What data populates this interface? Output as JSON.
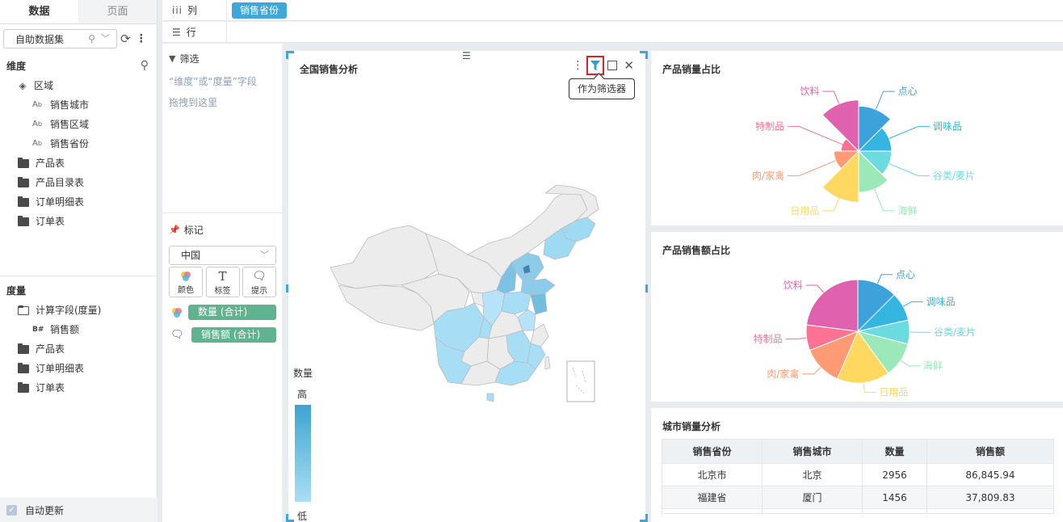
{
  "left": {
    "tabs": [
      "数据",
      "页面"
    ],
    "dataset": "自助数据集",
    "dim_title": "维度",
    "dim_root": "区域",
    "dim_children": [
      {
        "label": "销售城市"
      },
      {
        "label": "销售区域"
      },
      {
        "label": "销售省份"
      }
    ],
    "dim_tables": [
      "产品表",
      "产品目录表",
      "订单明细表",
      "订单表"
    ],
    "measure_title": "度量",
    "measure_root": "计算字段(度量)",
    "measure_child": "销售额",
    "measure_tables": [
      "产品表",
      "订单明细表",
      "订单表"
    ],
    "auto_update": "自动更新"
  },
  "bars": {
    "col_label": "列",
    "col_pill": "销售省份",
    "row_label": "行"
  },
  "mid": {
    "filter_title": "筛选",
    "filter_hint_1": "“维度”或“度量”字段",
    "filter_hint_2": "拖拽到这里",
    "mark_title": "标记",
    "mark_select": "中国",
    "btn_color": "颜色",
    "btn_label": "标签",
    "btn_tip": "提示",
    "field_1": "数量 (合计)",
    "field_2": "销售额 (合计)"
  },
  "map": {
    "title": "全国销售分析",
    "tooltip": "作为筛选器",
    "legend_title": "数量",
    "legend_hi": "高",
    "legend_lo": "低"
  },
  "chart_data": [
    {
      "type": "pie",
      "title": "产品销量占比",
      "variant": "rose",
      "categories": [
        "点心",
        "调味品",
        "谷类/麦片",
        "海鲜",
        "日用品",
        "肉/家禽",
        "特制品",
        "饮料"
      ],
      "radius_values": [
        0.82,
        0.6,
        0.6,
        0.75,
        0.93,
        0.45,
        0.32,
        0.93
      ],
      "colors": [
        "#3da2da",
        "#35b6e0",
        "#6cdbe0",
        "#9be8b8",
        "#fed85f",
        "#ff9b74",
        "#fb7293",
        "#e062ae"
      ]
    },
    {
      "type": "pie",
      "title": "产品销售额占比",
      "categories": [
        "点心",
        "调味品",
        "谷类/麦片",
        "海鲜",
        "日用品",
        "肉/家禽",
        "特制品",
        "饮料"
      ],
      "values": [
        12.5,
        9,
        7.5,
        11,
        16.5,
        12.5,
        8,
        23
      ],
      "colors": [
        "#3da2da",
        "#35b6e0",
        "#6cdbe0",
        "#9be8b8",
        "#fed85f",
        "#ff9b74",
        "#fb7293",
        "#e062ae"
      ]
    }
  ],
  "table": {
    "title": "城市销量分析",
    "headers": [
      "销售省份",
      "销售城市",
      "数量",
      "销售额"
    ],
    "rows": [
      [
        "北京市",
        "北京",
        "2956",
        "86,845.94"
      ],
      [
        "福建省",
        "厦门",
        "1456",
        "37,809.83"
      ]
    ]
  }
}
